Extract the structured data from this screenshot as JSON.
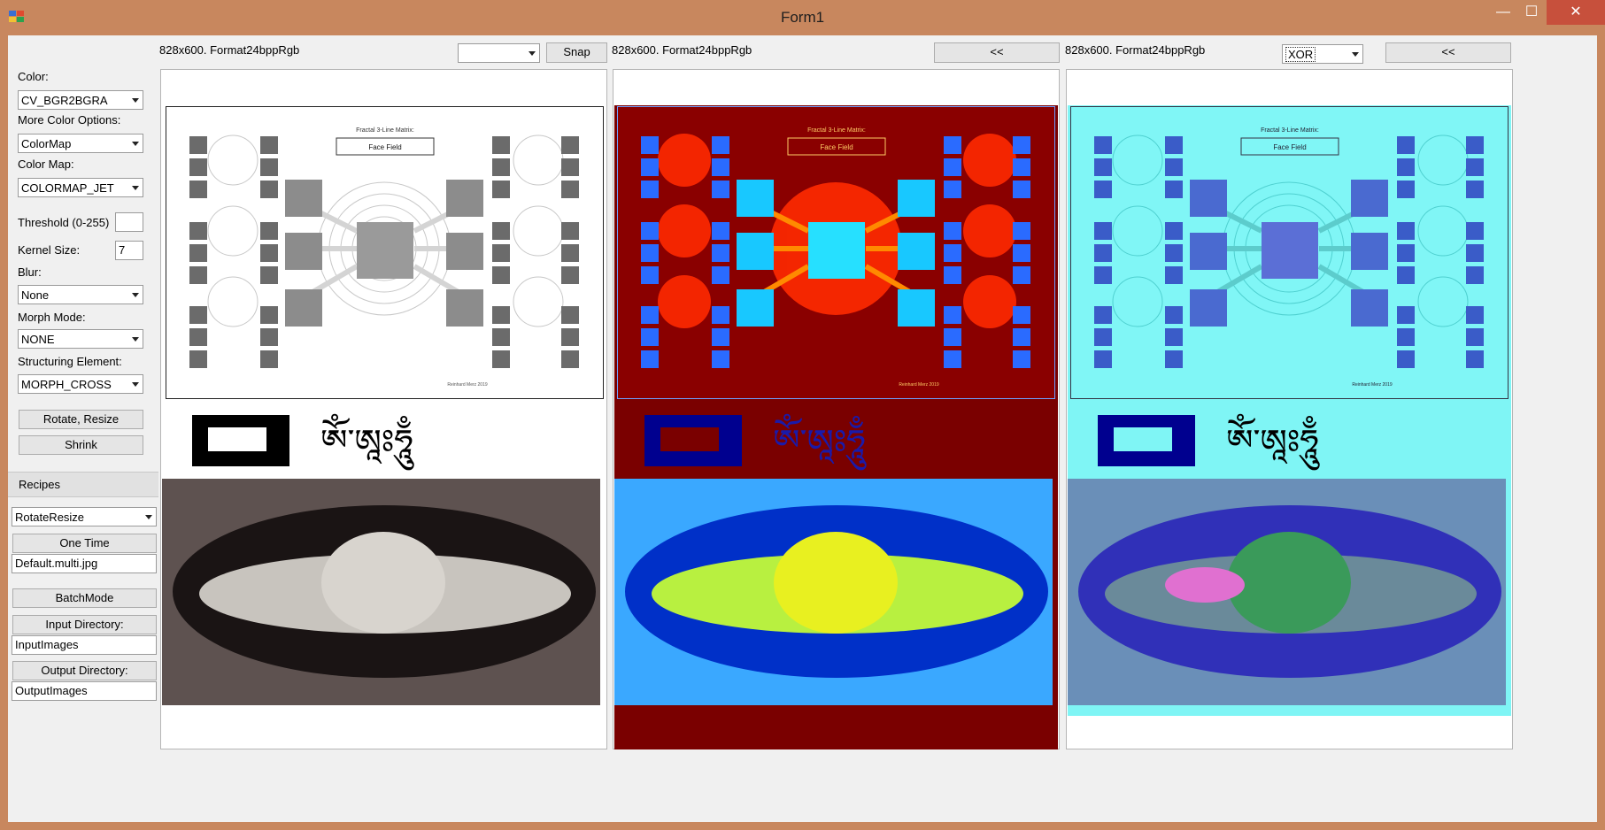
{
  "window": {
    "title": "Form1",
    "minimize": "—",
    "maximize": "☐",
    "close": "✕"
  },
  "controls": {
    "color_label": "Color:",
    "color_value": "CV_BGR2BGRA",
    "more_color_label": "More Color Options:",
    "more_color_value": "ColorMap",
    "colormap_label": "Color Map:",
    "colormap_value": "COLORMAP_JET",
    "threshold_label": "Threshold (0-255)",
    "threshold_value": "",
    "kernel_label": "Kernel Size:",
    "kernel_value": "7",
    "blur_label": "Blur:",
    "blur_value": "None",
    "morph_label": "Morph Mode:",
    "morph_value": "NONE",
    "struct_label": "Structuring Element:",
    "struct_value": "MORPH_CROSS",
    "rotate_button": "Rotate, Resize",
    "shrink_button": "Shrink"
  },
  "recipes": {
    "header": "Recipes",
    "recipe_value": "RotateResize",
    "one_time_button": "One Time",
    "file_value": "Default.multi.jpg",
    "batch_button": "BatchMode",
    "input_dir_button": "Input Directory:",
    "input_dir_value": "InputImages",
    "output_dir_button": "Output Directory:",
    "output_dir_value": "OutputImages"
  },
  "panels": {
    "p1_info": "828x600. Format24bppRgb",
    "p1_combo": "",
    "p1_snap": "Snap",
    "p2_info": "828x600. Format24bppRgb",
    "p2_button": "<<",
    "p3_info": "828x600. Format24bppRgb",
    "p3_combo": "XOR",
    "p3_button": "<<"
  },
  "poster": {
    "title": "Fractal 3-Line Matrix:",
    "box": "Face Field",
    "credit": "Reinhard Merz 2019"
  },
  "tibetan": "ཨོཾ་ཨཱཿཧཱུྃ",
  "colors": {
    "titlebar": "#c8875e",
    "client": "#f0f0f0",
    "p2_bg": "#7a0000",
    "p3_bg": "#7ff5f5"
  }
}
